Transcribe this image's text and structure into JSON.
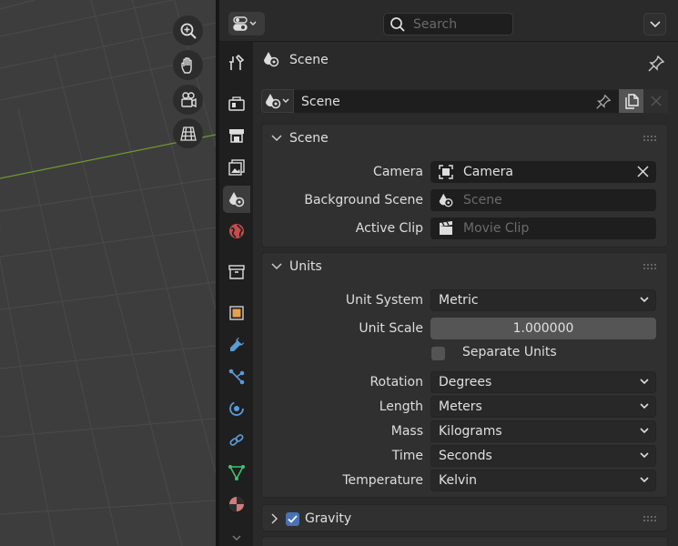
{
  "header": {
    "search_placeholder": "Search"
  },
  "context": {
    "title": "Scene"
  },
  "datablock": {
    "name": "Scene"
  },
  "scene_panel": {
    "title": "Scene",
    "camera_label": "Camera",
    "camera_value": "Camera",
    "background_label": "Background Scene",
    "background_placeholder": "Scene",
    "clip_label": "Active Clip",
    "clip_placeholder": "Movie Clip"
  },
  "units_panel": {
    "title": "Units",
    "unit_system_label": "Unit System",
    "unit_system_value": "Metric",
    "unit_scale_label": "Unit Scale",
    "unit_scale_value": "1.000000",
    "separate_units_label": "Separate Units",
    "rotation_label": "Rotation",
    "rotation_value": "Degrees",
    "length_label": "Length",
    "length_value": "Meters",
    "mass_label": "Mass",
    "mass_value": "Kilograms",
    "time_label": "Time",
    "time_value": "Seconds",
    "temperature_label": "Temperature",
    "temperature_value": "Kelvin"
  },
  "gravity_panel": {
    "title": "Gravity",
    "enabled": true
  },
  "colors": {
    "accent": "#4772b3",
    "axis_green": "#6c9b2f"
  }
}
